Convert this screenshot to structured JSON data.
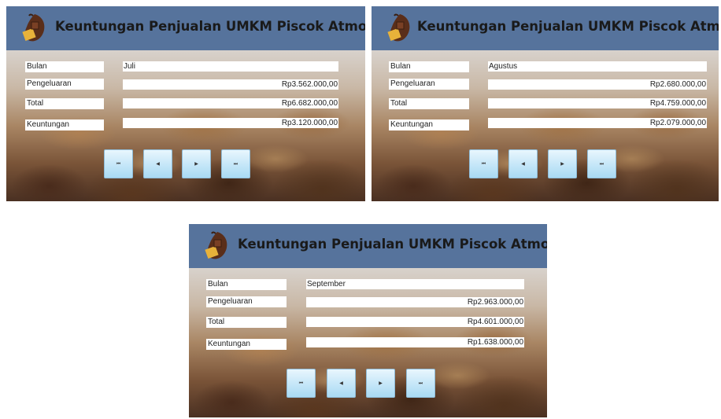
{
  "app": {
    "title": "Keuntungan Penjualan UMKM Piscok Atmojo",
    "logo_icon": "piscok-logo-icon"
  },
  "labels": {
    "bulan": "Bulan",
    "pengeluaran": "Pengeluaran",
    "total": "Total",
    "keuntungan": "Keuntungan"
  },
  "nav": {
    "first_glyph": "⏮",
    "prev_glyph": "◀",
    "next_glyph": "▶",
    "last_glyph": "⏭",
    "first_icon": "first-record-icon",
    "prev_icon": "previous-record-icon",
    "next_icon": "next-record-icon",
    "last_icon": "last-record-icon"
  },
  "screens": [
    {
      "bulan": "Juli",
      "pengeluaran": "Rp3.562.000,00",
      "total": "Rp6.682.000,00",
      "keuntungan": "Rp3.120.000,00"
    },
    {
      "bulan": "Agustus",
      "pengeluaran": "Rp2.680.000,00",
      "total": "Rp4.759.000,00",
      "keuntungan": "Rp2.079.000,00"
    },
    {
      "bulan": "September",
      "pengeluaran": "Rp2.963.000,00",
      "total": "Rp4.601.000,00",
      "keuntungan": "Rp1.638.000,00"
    }
  ],
  "colors": {
    "title_bar": "#56739c",
    "button_gradient_top": "#e9f6fd",
    "button_gradient_bottom": "#a9daf3"
  }
}
